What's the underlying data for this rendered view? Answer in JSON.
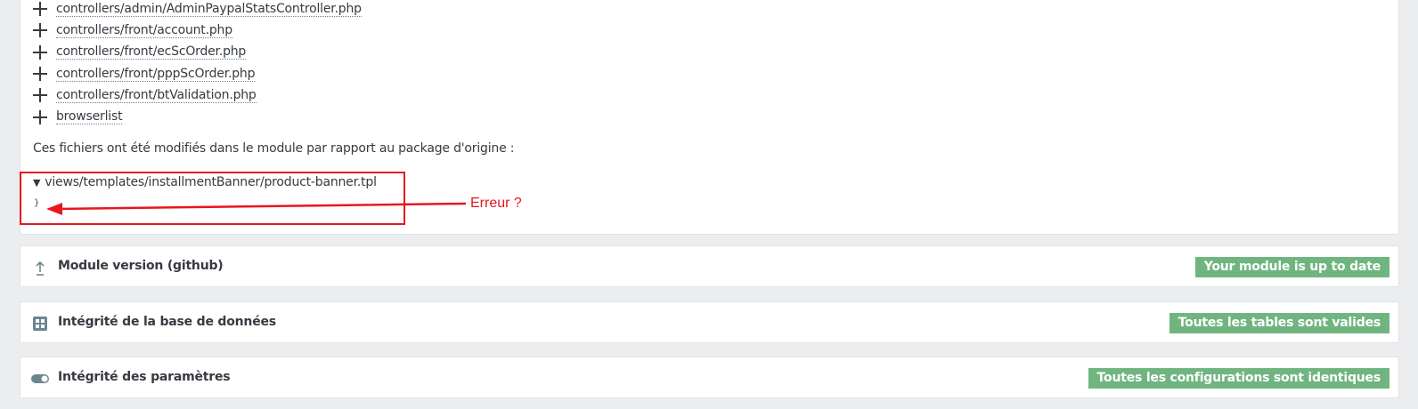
{
  "files_added": [
    "controllers/admin/AdminPaypalStatsController.php",
    "controllers/front/account.php",
    "controllers/front/ecScOrder.php",
    "controllers/front/pppScOrder.php",
    "controllers/front/btValidation.php",
    "browserlist"
  ],
  "modified_intro": "Ces fichiers ont été modifiés dans le module par rapport au package d'origine :",
  "modified_file": {
    "name": "views/templates/installmentBanner/product-banner.tpl",
    "content": "}"
  },
  "annotation": {
    "text": "Erreur ?",
    "color": "#e8161d"
  },
  "panels": [
    {
      "title": "Module version (github)",
      "badge": "Your module is up to date",
      "icon": "upload-arrow-icon"
    },
    {
      "title": "Intégrité de la base de données",
      "badge": "Toutes les tables sont valides",
      "icon": "grid-icon"
    },
    {
      "title": "Intégrité des paramètres",
      "badge": "Toutes les configurations sont identiques",
      "icon": "toggle-icon"
    }
  ],
  "colors": {
    "background": "#ebedef",
    "badge_success": "#70b580",
    "text": "#363a41",
    "highlight": "#e8161d"
  }
}
